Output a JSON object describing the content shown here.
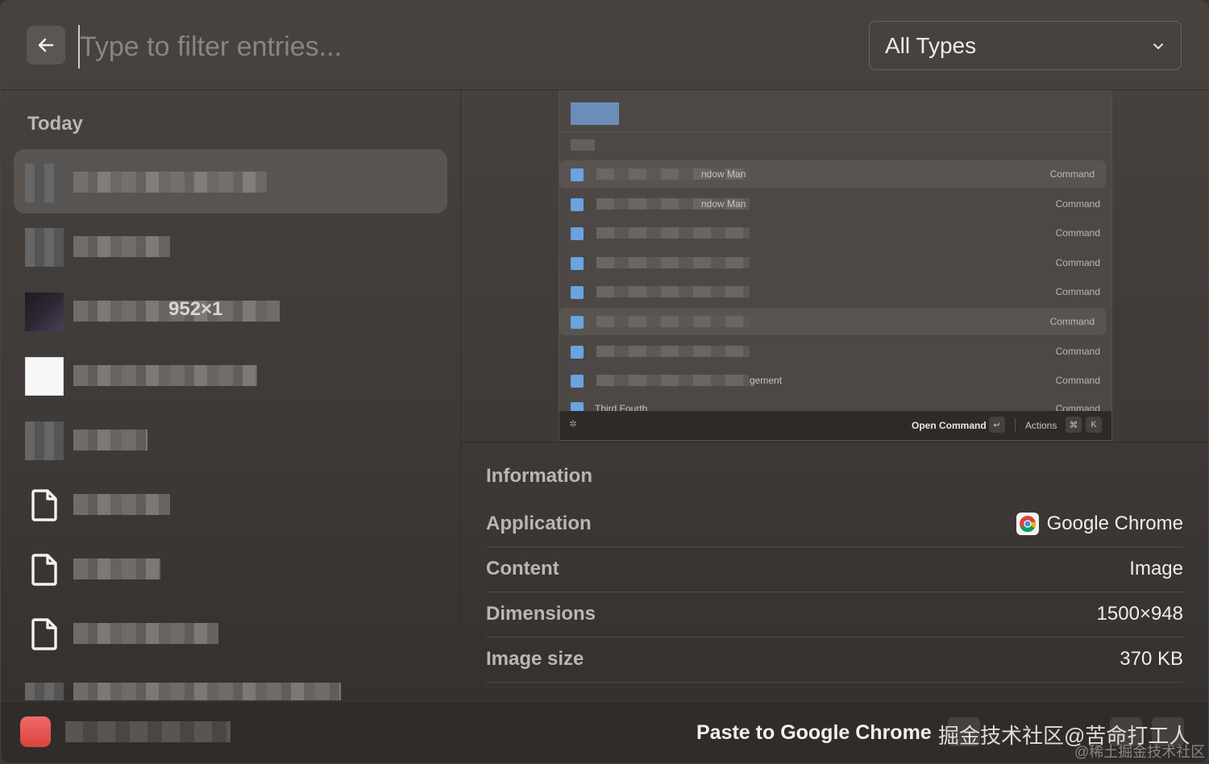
{
  "header": {
    "search_placeholder": "Type to filter entries...",
    "type_filter": "All Types"
  },
  "sidebar": {
    "section_title": "Today",
    "items": [
      {
        "label_visible": "",
        "kind": "image"
      },
      {
        "label_visible": "",
        "kind": "image"
      },
      {
        "label_visible": "952×1",
        "kind": "image"
      },
      {
        "label_visible": "",
        "kind": "image"
      },
      {
        "label_visible": "",
        "kind": "image"
      },
      {
        "label_visible": "",
        "kind": "file"
      },
      {
        "label_visible": "",
        "kind": "file"
      },
      {
        "label_visible": "",
        "kind": "file"
      },
      {
        "label_visible": "",
        "kind": "image"
      }
    ]
  },
  "preview": {
    "rows": [
      {
        "text": "ndow Man",
        "command": "Command",
        "highlight": true
      },
      {
        "text": "ndow Man",
        "command": "Command",
        "highlight": false
      },
      {
        "text": "",
        "command": "Command",
        "highlight": false
      },
      {
        "text": "",
        "command": "Command",
        "highlight": false
      },
      {
        "text": "",
        "command": "Command",
        "highlight": false
      },
      {
        "text": "",
        "command": "Command",
        "highlight": true
      },
      {
        "text": "",
        "command": "Command",
        "highlight": false
      },
      {
        "text": "gement",
        "command": "Command",
        "highlight": false
      },
      {
        "text": "Third Fourth",
        "command": "Command",
        "highlight": false
      }
    ],
    "footer": {
      "open": "Open Command",
      "enter_key": "↵",
      "actions": "Actions",
      "cmd_key": "⌘",
      "k_key": "K"
    }
  },
  "info": {
    "title": "Information",
    "rows": [
      {
        "key": "Application",
        "value": "Google Chrome"
      },
      {
        "key": "Content",
        "value": "Image"
      },
      {
        "key": "Dimensions",
        "value": "1500×948"
      },
      {
        "key": "Image size",
        "value": "370 KB"
      }
    ]
  },
  "footer": {
    "primary_action": "Paste to Google Chrome",
    "watermark": "掘金技术社区@苦命打工人",
    "watermark_small": "@稀土掘金技术社区"
  },
  "colors": {
    "window_bg": "#49433f",
    "selected_item_bg": "#5a5451",
    "accent_blue": "#6aa3e0"
  }
}
